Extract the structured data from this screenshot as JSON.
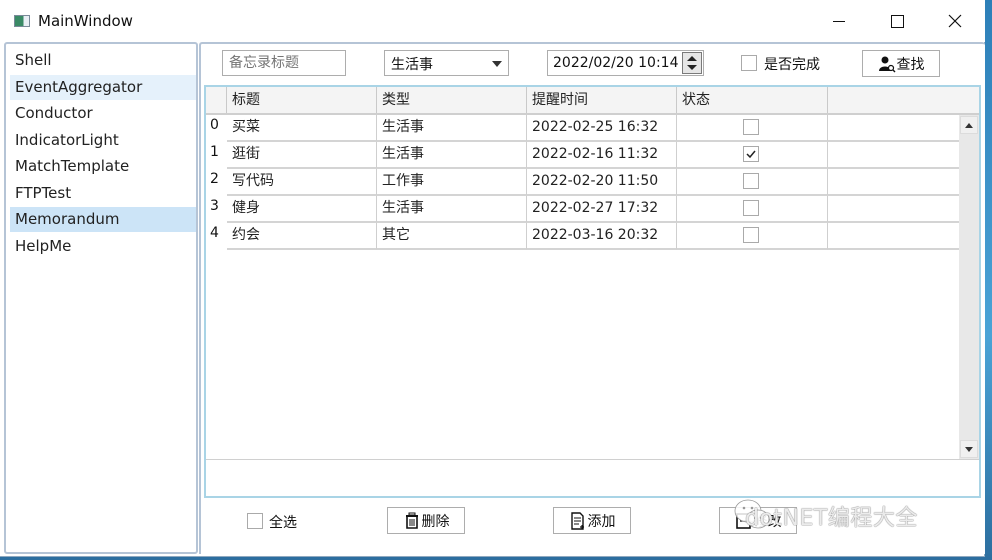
{
  "window": {
    "title": "MainWindow",
    "controls": {
      "minimize": "minimize",
      "maximize": "maximize",
      "close": "close"
    }
  },
  "sidebar": {
    "items": [
      {
        "label": "Shell",
        "state": "normal"
      },
      {
        "label": "EventAggregator",
        "state": "hover"
      },
      {
        "label": "Conductor",
        "state": "normal"
      },
      {
        "label": "IndicatorLight",
        "state": "normal"
      },
      {
        "label": "MatchTemplate",
        "state": "normal"
      },
      {
        "label": "FTPTest",
        "state": "normal"
      },
      {
        "label": "Memorandum",
        "state": "selected"
      },
      {
        "label": "HelpMe",
        "state": "normal"
      }
    ]
  },
  "filter": {
    "title_placeholder": "备忘录标题",
    "title_value": "",
    "type_selected": "生活事",
    "datetime_value": "2022/02/20 10:14",
    "completed_label": "是否完成",
    "completed_checked": false,
    "search_label": "查找",
    "search_icon": "user-search-icon"
  },
  "grid": {
    "columns": [
      "标题",
      "类型",
      "提醒时间",
      "状态"
    ],
    "rows": [
      {
        "index": "0",
        "title": "买菜",
        "type": "生活事",
        "remind_time": "2022-02-25 16:32",
        "done": false
      },
      {
        "index": "1",
        "title": "逛街",
        "type": "生活事",
        "remind_time": "2022-02-16 11:32",
        "done": true
      },
      {
        "index": "2",
        "title": "写代码",
        "type": "工作事",
        "remind_time": "2022-02-20 11:50",
        "done": false
      },
      {
        "index": "3",
        "title": "健身",
        "type": "生活事",
        "remind_time": "2022-02-27 17:32",
        "done": false
      },
      {
        "index": "4",
        "title": "约会",
        "type": "其它",
        "remind_time": "2022-03-16 20:32",
        "done": false
      }
    ]
  },
  "actions": {
    "select_all_label": "全选",
    "select_all_checked": false,
    "delete_label": "删除",
    "delete_icon": "trash-icon",
    "add_label": "添加",
    "add_icon": "document-add-icon",
    "edit_label": "修改",
    "edit_icon": "edit-icon"
  },
  "watermark": {
    "text": "dotNET编程大全"
  },
  "colors": {
    "selected": "#cce4f7",
    "hover": "#e5f1fb",
    "grid_border": "#a9d4e6",
    "sidebar_border": "#b5c4d6"
  }
}
